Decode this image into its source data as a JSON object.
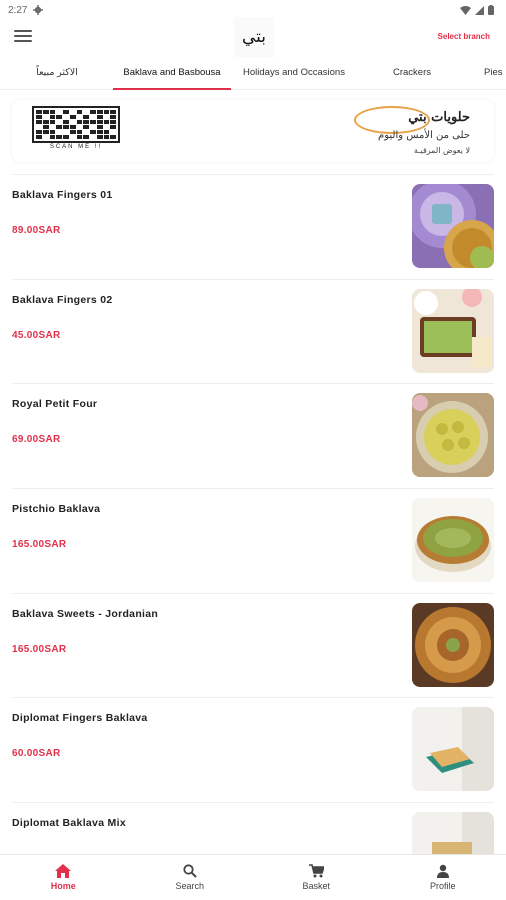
{
  "status_bar": {
    "time": "2:27"
  },
  "app_bar": {
    "logo_text": "بتي",
    "select_branch": "Select branch"
  },
  "tabs": [
    {
      "label": "الاكثر مبيعاً",
      "active": false
    },
    {
      "label": "Baklava and Basbousa",
      "active": true
    },
    {
      "label": "Holidays and Occasions",
      "active": false
    },
    {
      "label": "Crackers",
      "active": false
    },
    {
      "label": "Pies",
      "active": false
    }
  ],
  "banner": {
    "qr_caption": "SCAN ME !!",
    "brand_name": "حلويات بتي",
    "brand_line": "حلى من الأمس واليوم",
    "brand_tag": "لا يعوض المرقيـة"
  },
  "products": [
    {
      "name": "Baklava Fingers 01",
      "price": "89.00SAR",
      "image": "purple-tin-baklava"
    },
    {
      "name": "Baklava Fingers 02",
      "price": "45.00SAR",
      "image": "tray-with-tea"
    },
    {
      "name": "Royal Petit Four",
      "price": "69.00SAR",
      "image": "round-tray-petit-four"
    },
    {
      "name": "Pistchio Baklava",
      "price": "165.00SAR",
      "image": "pistachio-round-tray"
    },
    {
      "name": "Baklava Sweets - Jordanian",
      "price": "165.00SAR",
      "image": "jordanian-mixed-tray"
    },
    {
      "name": "Diplomat Fingers Baklava",
      "price": "60.00SAR",
      "image": "small-box-fingers"
    },
    {
      "name": "Diplomat Baklava Mix",
      "price": "",
      "image": "box-baklava-mix"
    }
  ],
  "bottom_nav": [
    {
      "label": "Home",
      "icon": "home-icon",
      "active": true
    },
    {
      "label": "Search",
      "icon": "search-icon",
      "active": false
    },
    {
      "label": "Basket",
      "icon": "cart-icon",
      "active": false
    },
    {
      "label": "Profile",
      "icon": "person-icon",
      "active": false
    }
  ],
  "colors": {
    "accent": "#e0304a",
    "divider": "#eeeeee"
  }
}
